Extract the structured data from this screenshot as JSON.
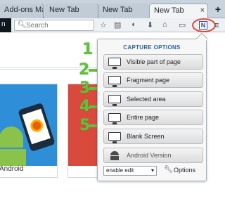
{
  "browser": {
    "tabs": [
      {
        "label": "Add-ons Ma",
        "active": false
      },
      {
        "label": "New Tab",
        "active": false
      },
      {
        "label": "New Tab",
        "active": false
      },
      {
        "label": "New Tab",
        "active": true
      }
    ],
    "active_tab_close": "×",
    "new_tab_button": "+",
    "search_placeholder": "Search"
  },
  "page": {
    "tile_caption": "Android"
  },
  "panel": {
    "title": "CAPTURE OPTIONS",
    "items": [
      {
        "label": "Visible part of page"
      },
      {
        "label": "Fragment page"
      },
      {
        "label": "Selected area"
      },
      {
        "label": "Entire page"
      },
      {
        "label": "Blank Screen"
      },
      {
        "label": "Android Version"
      }
    ],
    "edit_select_value": "enable edit",
    "options_label": "Options"
  },
  "annotations": [
    "1",
    "2",
    "3",
    "4",
    "5"
  ],
  "colors": {
    "accent_green": "#5ec23a",
    "highlight_red": "#e0473f",
    "title_blue": "#2f5f9e"
  }
}
